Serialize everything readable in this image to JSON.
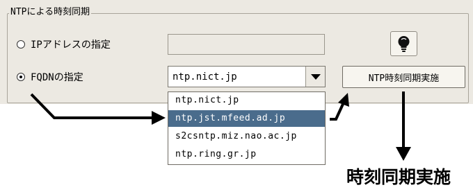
{
  "group": {
    "title": "NTPによる時刻同期"
  },
  "options": [
    {
      "label": "IPアドレスの指定",
      "selected": false
    },
    {
      "label": "FQDNの指定",
      "selected": true
    }
  ],
  "ip_field": {
    "value": ""
  },
  "fqdn_combo": {
    "value": "ntp.nict.jp"
  },
  "dropdown": {
    "items": [
      {
        "label": "ntp.nict.jp"
      },
      {
        "label": "ntp.jst.mfeed.ad.jp"
      },
      {
        "label": "s2csntp.miz.nao.ac.jp"
      },
      {
        "label": "ntp.ring.gr.jp"
      }
    ],
    "highlighted_index": 1
  },
  "buttons": {
    "sync": "NTP時刻同期実施",
    "bulb_icon": "lightbulb-icon"
  },
  "annotation": {
    "caption": "時刻同期実施"
  },
  "colors": {
    "highlight": "#4a6c8c",
    "panel": "#ece9e2"
  }
}
